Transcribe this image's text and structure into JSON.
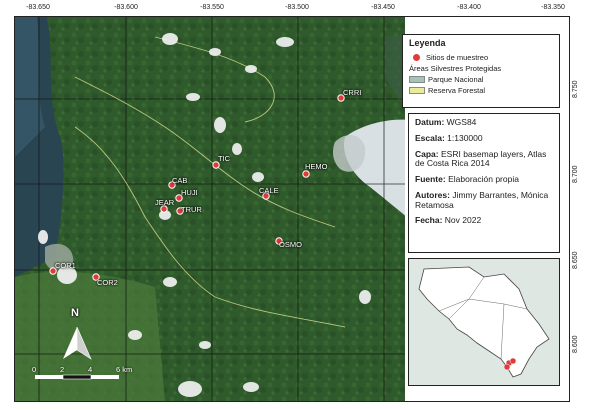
{
  "lon_ticks": [
    "-83.650",
    "-83.600",
    "-83.550",
    "-83.500",
    "-83.450",
    "-83.400",
    "-83.350"
  ],
  "lat_ticks": [
    "8.750",
    "8.700",
    "8.650",
    "8.600"
  ],
  "legend": {
    "title": "Leyenda",
    "sites": "Sitios de muestreo",
    "areas_title": "Áreas Silvestres Protegidas",
    "parque": "Parque Nacional",
    "reserva": "Reserva Forestal"
  },
  "info": {
    "datum_label": "Datum:",
    "datum_value": "WGS84",
    "escala_label": "Escala:",
    "escala_value": "1:130000",
    "capa_label": "Capa:",
    "capa_value": "ESRI basemap layers, Atlas de Costa Rica 2014",
    "fuente_label": "Fuente:",
    "fuente_value": "Elaboración propia",
    "autores_label": "Autores:",
    "autores_value": "Jimmy Barrantes, Mónica Retamosa",
    "fecha_label": "Fecha:",
    "fecha_value": "Nov 2022"
  },
  "north": "N",
  "scale": {
    "l0": "0",
    "l2": "2",
    "l4": "4",
    "l6": "6 km"
  },
  "sites": [
    {
      "name": "CRRI"
    },
    {
      "name": "TIC"
    },
    {
      "name": "HEMO"
    },
    {
      "name": "CAB"
    },
    {
      "name": "HUJI"
    },
    {
      "name": "CALE"
    },
    {
      "name": "JEAR"
    },
    {
      "name": "TRUR"
    },
    {
      "name": "OSMO"
    },
    {
      "name": "COR1"
    },
    {
      "name": "COR2"
    }
  ],
  "colors": {
    "site": "#e23a3a",
    "parque": "#9fc7b7",
    "reserva": "#e8eb9a",
    "forest": "#2f5a2c",
    "sea": "#2a4552",
    "gulf": "#d8e0e4"
  }
}
